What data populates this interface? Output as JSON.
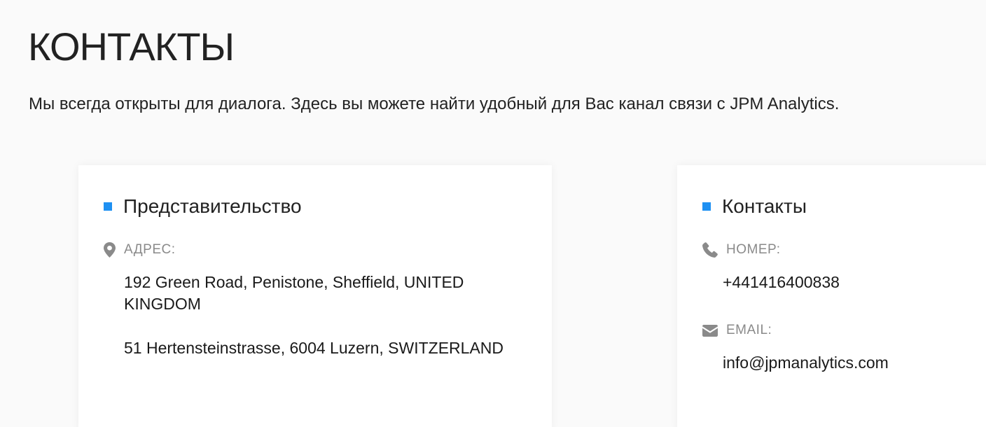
{
  "page": {
    "title": "КОНТАКТЫ",
    "subtitle": "Мы всегда открыты для диалога. Здесь вы можете найти удобный для Вас канал связи с JPM Analytics."
  },
  "office": {
    "title": "Представительство",
    "address_label": "АДРЕС:",
    "address_icon": "map-marker-icon",
    "addresses": [
      "192 Green Road, Penistone, Sheffield, UNITED KINGDOM",
      "51 Hertensteinstrasse, 6004 Luzern, SWITZERLAND"
    ]
  },
  "contacts": {
    "title": "Контакты",
    "phone_label": "НОМЕР:",
    "phone_icon": "phone-icon",
    "phone": "+441416400838",
    "email_label": "EMAIL:",
    "email_icon": "envelope-icon",
    "email": "info@jpmanalytics.com"
  },
  "colors": {
    "accent": "#1e90f2",
    "label": "#8a8a8a",
    "background": "#fafafa",
    "card": "#ffffff"
  }
}
